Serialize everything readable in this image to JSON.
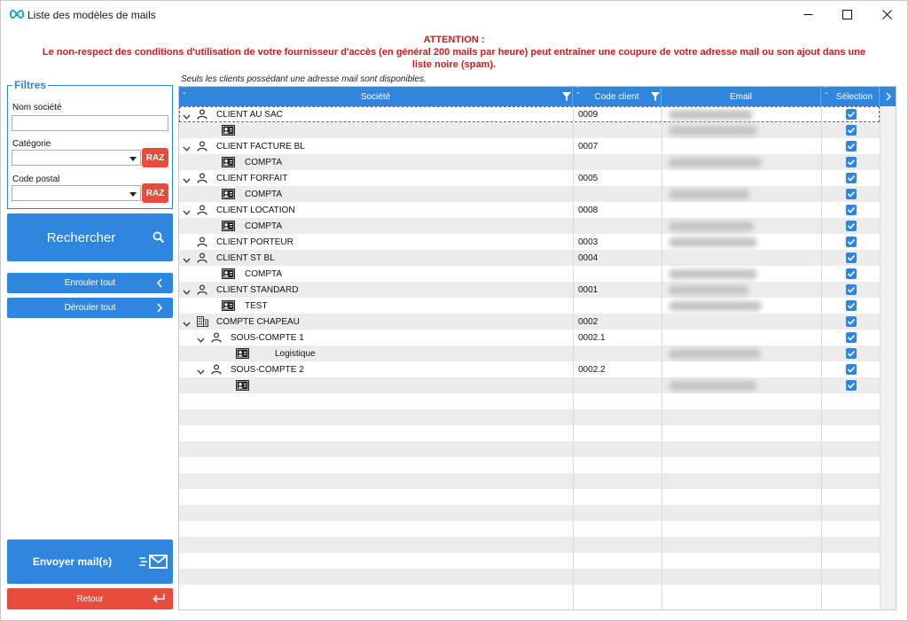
{
  "window": {
    "title": "Liste des modèles de mails"
  },
  "warning": {
    "title": "ATTENTION :",
    "line1": "Le non-respect des conditions d'utilisation de votre fournisseur d'accès (en général 200 mails par heure) peut entraîner une coupure de votre adresse mail ou son ajout dans une",
    "line2": "liste noire (spam)."
  },
  "filters": {
    "legend": "Filtres",
    "company_label": "Nom société",
    "category_label": "Catégorie",
    "postal_label": "Code postal",
    "raz_label": "RAZ"
  },
  "actions": {
    "search_label": "Rechercher",
    "collapse_label": "Enrouler tout",
    "expand_label": "Dérouler tout",
    "send_label": "Envoyer mail(s)",
    "back_label": "Retour"
  },
  "grid": {
    "note": "Seuls les clients possédant une adresse mail sont disponibles.",
    "columns": {
      "company": "Société",
      "code": "Code client",
      "email": "Email",
      "selection": "Sélection"
    },
    "rows": [
      {
        "level": 0,
        "icon": "user-icon",
        "expander": true,
        "label": "CLIENT AU SAC",
        "code": "0009",
        "email_hidden": true,
        "checked": true
      },
      {
        "level": 1,
        "icon": "contact-card-icon",
        "expander": false,
        "label": "",
        "code": "",
        "email_hidden": true,
        "checked": true
      },
      {
        "level": 0,
        "icon": "user-icon",
        "expander": true,
        "label": "CLIENT FACTURE BL",
        "code": "0007",
        "email_hidden": false,
        "checked": true
      },
      {
        "level": 1,
        "icon": "contact-card-icon",
        "expander": false,
        "label": "COMPTA",
        "code": "",
        "email_hidden": true,
        "checked": true
      },
      {
        "level": 0,
        "icon": "user-icon",
        "expander": true,
        "label": "CLIENT FORFAIT",
        "code": "0005",
        "email_hidden": false,
        "checked": true
      },
      {
        "level": 1,
        "icon": "contact-card-icon",
        "expander": false,
        "label": "COMPTA",
        "code": "",
        "email_hidden": true,
        "checked": true
      },
      {
        "level": 0,
        "icon": "user-icon",
        "expander": true,
        "label": "CLIENT LOCATION",
        "code": "0008",
        "email_hidden": false,
        "checked": true
      },
      {
        "level": 1,
        "icon": "contact-card-icon",
        "expander": false,
        "label": "COMPTA",
        "code": "",
        "email_hidden": true,
        "checked": true
      },
      {
        "level": 0,
        "icon": "user-icon",
        "expander": false,
        "label": "CLIENT PORTEUR",
        "code": "0003",
        "email_hidden": true,
        "checked": true
      },
      {
        "level": 0,
        "icon": "user-icon",
        "expander": true,
        "label": "CLIENT ST BL",
        "code": "0004",
        "email_hidden": false,
        "checked": true
      },
      {
        "level": 1,
        "icon": "contact-card-icon",
        "expander": false,
        "label": "COMPTA",
        "code": "",
        "email_hidden": true,
        "checked": true
      },
      {
        "level": 0,
        "icon": "user-icon",
        "expander": true,
        "label": "CLIENT STANDARD",
        "code": "0001",
        "email_hidden": true,
        "checked": true
      },
      {
        "level": 1,
        "icon": "contact-card-icon",
        "expander": false,
        "label": "TEST",
        "code": "",
        "email_hidden": true,
        "checked": true
      },
      {
        "level": 0,
        "icon": "building-icon",
        "expander": true,
        "label": "COMPTE CHAPEAU",
        "code": "0002",
        "email_hidden": false,
        "checked": true
      },
      {
        "level": 1,
        "icon": "user-icon",
        "expander": true,
        "label": "SOUS-COMPTE 1",
        "code": "0002.1",
        "email_hidden": false,
        "checked": true
      },
      {
        "level": 2,
        "icon": "contact-card-icon",
        "expander": false,
        "label": "Logistique",
        "code": "",
        "email_hidden": true,
        "checked": true
      },
      {
        "level": 1,
        "icon": "user-icon",
        "expander": true,
        "label": "SOUS-COMPTE 2",
        "code": "0002.2",
        "email_hidden": false,
        "checked": true
      },
      {
        "level": 2,
        "icon": "contact-card-icon",
        "expander": false,
        "label": "",
        "code": "",
        "email_hidden": true,
        "checked": true
      }
    ]
  },
  "colors": {
    "accent": "#2e86de",
    "danger": "#e74c3c",
    "warning_text": "#d4191c",
    "row_alt": "#ececec"
  }
}
